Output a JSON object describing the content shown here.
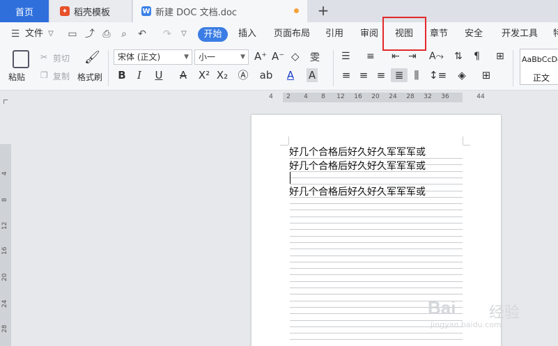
{
  "tabs": {
    "home": "首页",
    "template": "稻壳模板",
    "document": "新建 DOC 文档.doc",
    "doc_icon": "W",
    "new_tab": "+"
  },
  "menu": {
    "file": "文件",
    "items": [
      "开始",
      "插入",
      "页面布局",
      "引用",
      "审阅",
      "视图",
      "章节",
      "安全",
      "开发工具",
      "特"
    ],
    "active": "开始",
    "highlighted": "视图"
  },
  "ribbon": {
    "paste": "粘贴",
    "cut": "剪切",
    "copy": "复制",
    "format_painter": "格式刷",
    "font_name": "宋体 (正文)",
    "font_size": "小一",
    "styles_preview": "AaBbCcDd",
    "style_name": "正文"
  },
  "ruler": {
    "h_ticks": [
      "4",
      "2",
      "4",
      "8",
      "12",
      "16",
      "20",
      "24",
      "28",
      "32",
      "36",
      "44"
    ],
    "v_ticks": [
      "4",
      "8",
      "12",
      "16",
      "20",
      "24",
      "28"
    ]
  },
  "document": {
    "lines": [
      "好几个合格后好久好久军军军或",
      "好几个合格后好久好久军军军或",
      "",
      "好几个合格后好久好久军军军或"
    ]
  },
  "watermark": {
    "brand": "Bai",
    "suffix": "经验",
    "url": "jingyan.baidu.com"
  },
  "colors": {
    "accent": "#2e6fdc",
    "active_pill": "#3b7de4",
    "highlight_border": "#e2282a",
    "unsaved_dot": "#f5a23a"
  }
}
